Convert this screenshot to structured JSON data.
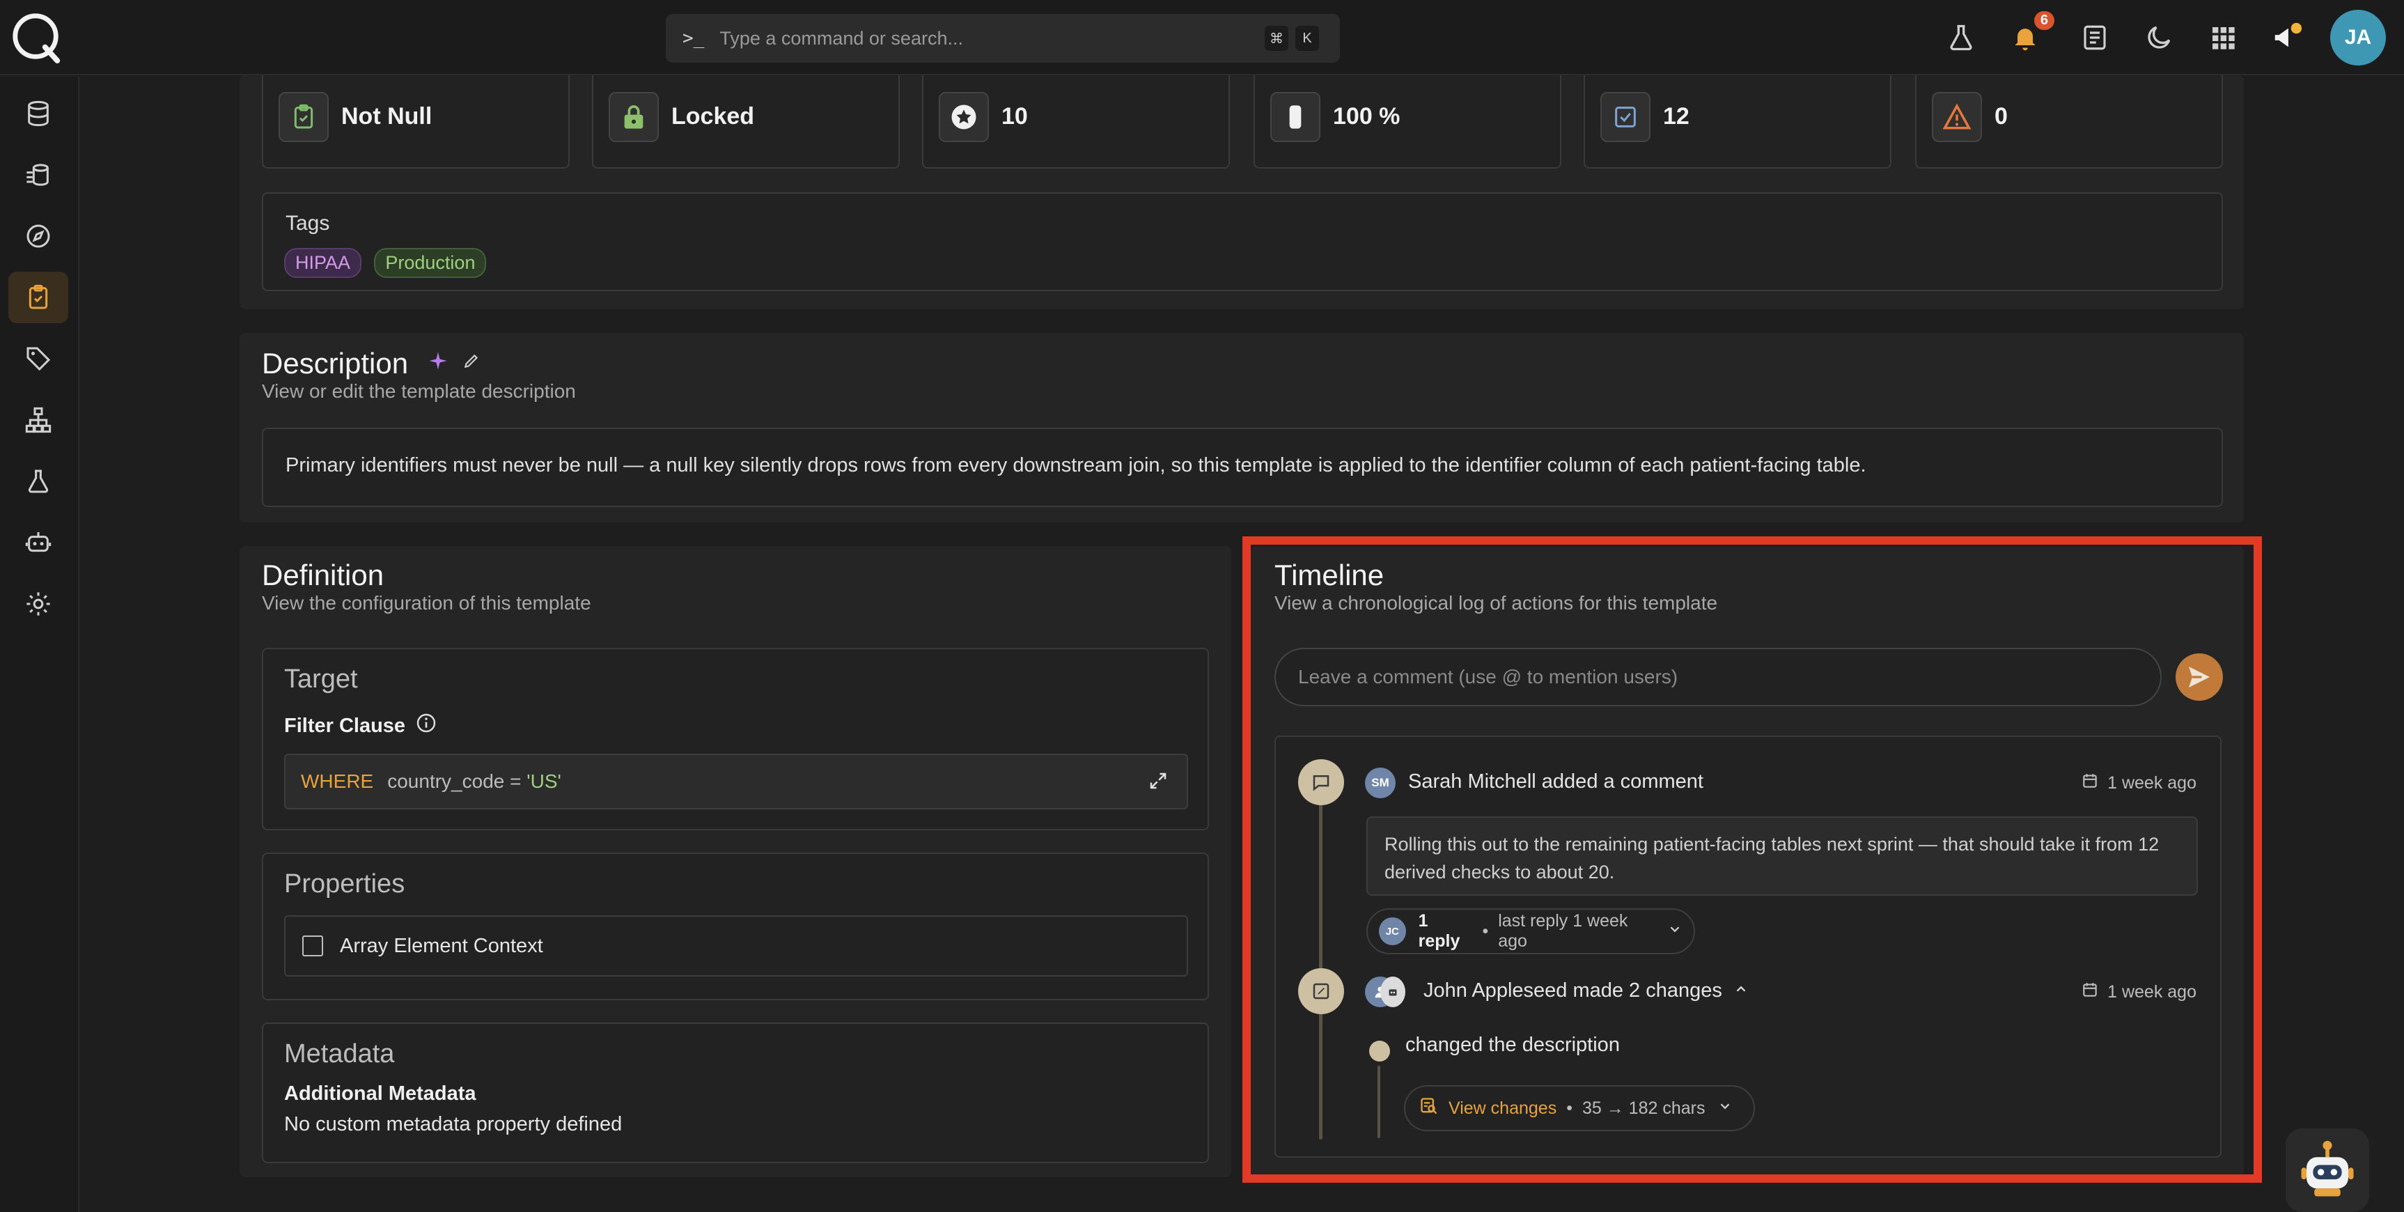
{
  "search": {
    "placeholder": "Type a command or search...",
    "kbd1": "⌘",
    "kbd2": "K"
  },
  "topbar": {
    "notification_count": "6",
    "user_initials": "JA"
  },
  "stats": [
    {
      "label": "Not Null"
    },
    {
      "label": "Locked"
    },
    {
      "label": "10"
    },
    {
      "label": "100 %"
    },
    {
      "label": "12"
    },
    {
      "label": "0"
    }
  ],
  "tags": {
    "title": "Tags",
    "items": [
      "HIPAA",
      "Production"
    ]
  },
  "description": {
    "title": "Description",
    "subtitle": "View or edit the template description",
    "text": "Primary identifiers must never be null — a null key silently drops rows from every downstream join, so this template is applied to the identifier column of each patient-facing table."
  },
  "definition": {
    "title": "Definition",
    "subtitle": "View the configuration of this template",
    "target_title": "Target",
    "filter_label": "Filter Clause",
    "where_kw": "WHERE",
    "where_field": "country_code = ",
    "where_value": "'US'",
    "properties_title": "Properties",
    "array_label": "Array Element Context",
    "metadata_title": "Metadata",
    "metadata_label": "Additional Metadata",
    "metadata_text": "No custom metadata property defined"
  },
  "timeline": {
    "title": "Timeline",
    "subtitle": "View a chronological log of actions for this template",
    "comment_placeholder": "Leave a comment (use @ to mention users)",
    "events": [
      {
        "initials": "SM",
        "actor_text": "Sarah Mitchell added a comment",
        "time": "1 week ago",
        "comment": "Rolling this out to the remaining patient-facing tables next sprint — that should take it from 12 derived checks to about 20.",
        "reply_initials": "JC",
        "reply_count": "1 reply",
        "reply_meta": "last reply 1 week ago"
      },
      {
        "actor_text": "John Appleseed made 2 changes",
        "time": "1 week ago",
        "change_text": "changed the description",
        "view_changes": "View changes",
        "change_meta": "35 → 182 chars"
      }
    ]
  }
}
